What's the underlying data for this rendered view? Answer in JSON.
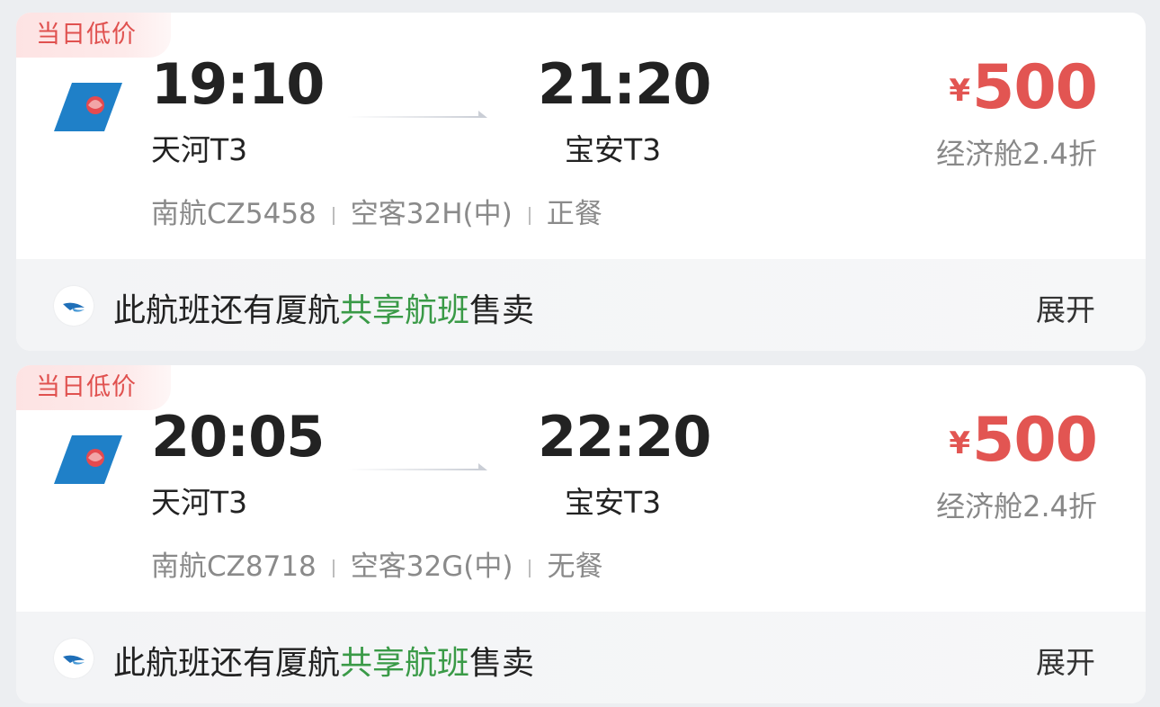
{
  "flights": [
    {
      "tag": "当日低价",
      "dep_time": "19:10",
      "arr_time": "21:20",
      "dep_airport": "天河T3",
      "arr_airport": "宝安T3",
      "currency": "¥",
      "price": "500",
      "cabin": "经济舱2.4折",
      "airline_flight": "南航CZ5458",
      "aircraft": "空客32H(中)",
      "meal": "正餐",
      "share_prefix": "此航班还有厦航",
      "share_highlight": "共享航班",
      "share_suffix": "售卖",
      "expand_label": "展开"
    },
    {
      "tag": "当日低价",
      "dep_time": "20:05",
      "arr_time": "22:20",
      "dep_airport": "天河T3",
      "arr_airport": "宝安T3",
      "currency": "¥",
      "price": "500",
      "cabin": "经济舱2.4折",
      "airline_flight": "南航CZ8718",
      "aircraft": "空客32G(中)",
      "meal": "无餐",
      "share_prefix": "此航班还有厦航",
      "share_highlight": "共享航班",
      "share_suffix": "售卖",
      "expand_label": "展开"
    }
  ],
  "colors": {
    "price": "#e25552",
    "highlight": "#3a9a47",
    "tag_text": "#e0514f"
  },
  "icons": {
    "airline_logo": "china-southern-logo-icon",
    "share_airline_logo": "xiamen-airlines-logo-icon"
  }
}
